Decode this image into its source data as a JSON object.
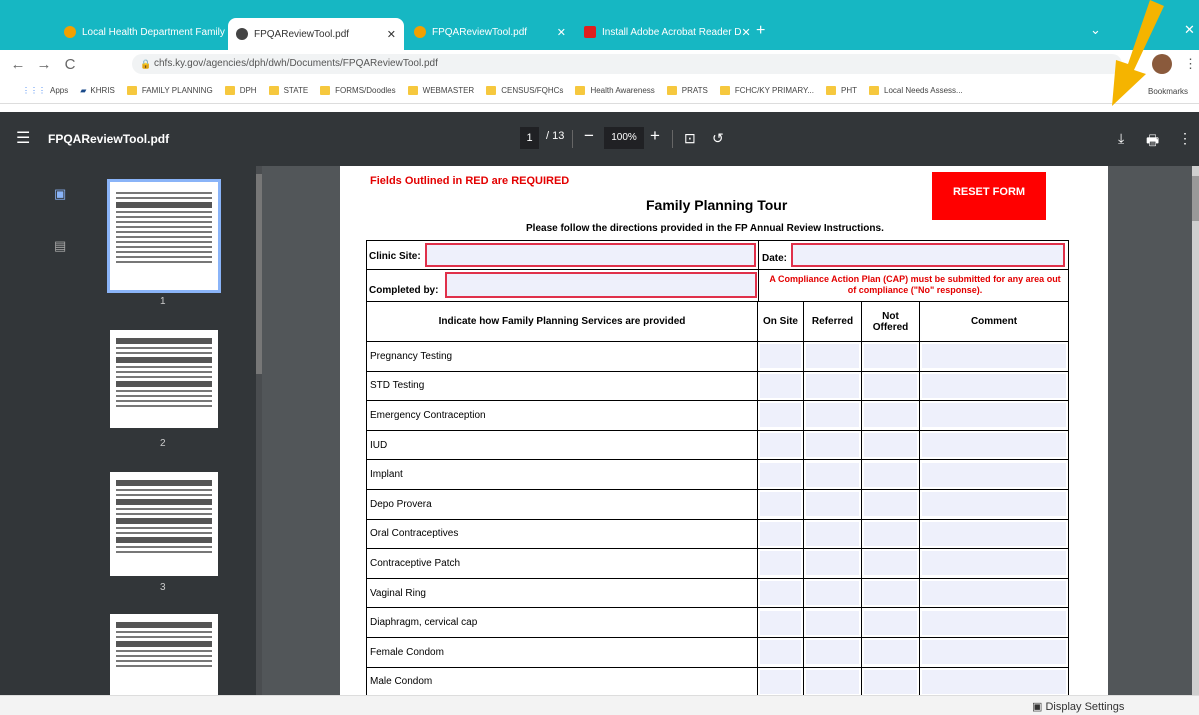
{
  "browser": {
    "tabs": [
      {
        "label": "Local Health Department Family",
        "active": false
      },
      {
        "label": "FPQAReviewTool.pdf",
        "active": true
      },
      {
        "label": "FPQAReviewTool.pdf",
        "active": false
      },
      {
        "label": "Install Adobe Acrobat Reader D",
        "active": false
      }
    ],
    "url": "chfs.ky.gov/agencies/dph/dwh/Documents/FPQAReviewTool.pdf",
    "bookmarks": [
      "Apps",
      "KHRIS",
      "FAMILY PLANNING",
      "DPH",
      "STATE",
      "FORMS/Doodles",
      "WEBMASTER",
      "CENSUS/FQHCs",
      "Health Awareness",
      "PRATS",
      "FCHC/KY PRIMARY...",
      "PHT",
      "Local Needs Assess..."
    ],
    "bookmarks_right": "Bookmarks"
  },
  "pdf": {
    "filename": "FPQAReviewTool.pdf",
    "page": "1",
    "page_count": "/ 13",
    "zoom": "100%",
    "thumb_labels": [
      "1",
      "2",
      "3"
    ]
  },
  "form": {
    "required_note": "Fields Outlined in RED are REQUIRED",
    "title": "Family Planning Tour",
    "subtitle": "Please follow the directions provided in the FP Annual Review Instructions.",
    "reset_label": "RESET FORM",
    "clinic_label": "Clinic Site:",
    "date_label": "Date:",
    "completed_label": "Completed by:",
    "cap_note": "A Compliance Action Plan (CAP) must be submitted for any area out of compliance (\"No\" response).",
    "headers": [
      "Indicate how  Family Planning Services  are provided",
      "On Site",
      "Referred",
      "Not Offered",
      "Comment"
    ],
    "services": [
      "Pregnancy Testing",
      "STD Testing",
      "Emergency Contraception",
      "IUD",
      "Implant",
      "Depo Provera",
      "Oral Contraceptives",
      "Contraceptive Patch",
      "Vaginal Ring",
      "Diaphragm, cervical cap",
      "Female Condom",
      "Male Condom"
    ]
  },
  "taskbar": {
    "display_settings": "Display Settings"
  },
  "colors": {
    "tab_strip": "#16b7c3",
    "pdf_toolbar": "#323639",
    "required_red": "#e30000",
    "arrow": "#f5b400"
  }
}
